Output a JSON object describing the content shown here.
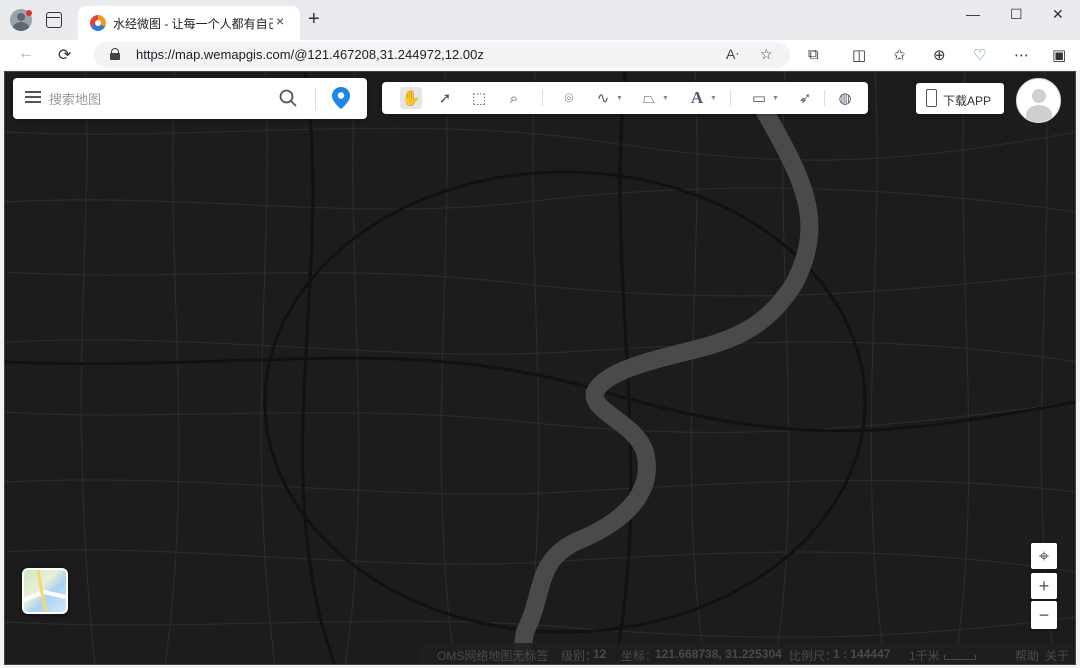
{
  "browser": {
    "tab_title": "水经微图 - 让每一个人都有自己的",
    "tab_close": "×",
    "new_tab": "+",
    "url": "https://map.wemapgis.com/@121.467208,31.244972,12.00z",
    "window_controls": [
      "—",
      "☐",
      "✕"
    ],
    "nav": {
      "back": "←",
      "reload": "⟳"
    },
    "toolbar_icons": [
      "read-aloud-icon",
      "favorite-icon",
      "extensions-icon",
      "split-screen-icon",
      "favorites-icon",
      "collections-icon",
      "performance-icon",
      "more-icon",
      "sidebar-icon"
    ]
  },
  "map": {
    "search": {
      "placeholder": "搜索地图"
    },
    "tools": [
      "pan-hand-icon",
      "select-arrow-icon",
      "box-select-icon",
      "zoom-box-icon",
      "place-marker-icon",
      "polyline-icon",
      "polygon-icon",
      "text-icon",
      "measure-icon",
      "identify-icon",
      "globe-icon"
    ],
    "download_app_label": "下载APP",
    "status": {
      "copyright": "OMS网络地图无标签",
      "level_label": "级别：",
      "level_value": "12",
      "coord_label": "坐标：",
      "coord_value": "121.668738, 31.225304",
      "scale_label": "比例尺：",
      "scale_value": "1 : 144447",
      "scale_bar_label": "1千米",
      "help": "帮助",
      "about": "关于"
    },
    "colors": {
      "background": "#1c1c1c",
      "roads": "#2b2b2b",
      "river": "#4a4a4a"
    }
  }
}
